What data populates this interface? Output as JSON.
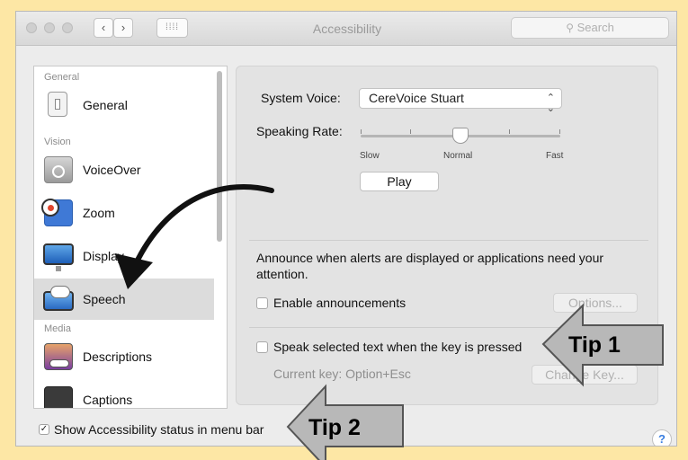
{
  "window": {
    "title": "Accessibility",
    "search_placeholder": "Search",
    "back_glyph": "‹",
    "forward_glyph": "›",
    "grid_glyph": "⁞⁞⁞⁞"
  },
  "sidebar": {
    "headers": [
      "General",
      "Vision",
      "Media"
    ],
    "items": [
      {
        "label": "General",
        "icon": "general-icon"
      },
      {
        "label": "VoiceOver",
        "icon": "voiceover-icon"
      },
      {
        "label": "Zoom",
        "icon": "zoom-icon"
      },
      {
        "label": "Display",
        "icon": "display-icon"
      },
      {
        "label": "Speech",
        "icon": "speech-icon",
        "selected": true
      },
      {
        "label": "Descriptions",
        "icon": "descriptions-icon"
      },
      {
        "label": "Captions",
        "icon": "captions-icon"
      }
    ]
  },
  "speech": {
    "system_voice_label": "System Voice:",
    "system_voice_value": "CereVoice Stuart",
    "speaking_rate_label": "Speaking Rate:",
    "rate_min_label": "Slow",
    "rate_mid_label": "Normal",
    "rate_max_label": "Fast",
    "rate_value_percent": 50,
    "play_label": "Play",
    "announce_text": "Announce when alerts are displayed or applications need your attention.",
    "enable_announcements_label": "Enable announcements",
    "enable_announcements_checked": false,
    "options_label": "Options...",
    "speak_selected_label": "Speak selected text when the key is pressed",
    "speak_selected_checked": false,
    "current_key_label": "Current key: Option+Esc",
    "change_key_label": "Change Key..."
  },
  "footer": {
    "show_status_label": "Show Accessibility status in menu bar",
    "show_status_checked": true,
    "check_glyph": "✓",
    "help_glyph": "?"
  },
  "annotations": {
    "tip1": "Tip 1",
    "tip2": "Tip 2"
  }
}
